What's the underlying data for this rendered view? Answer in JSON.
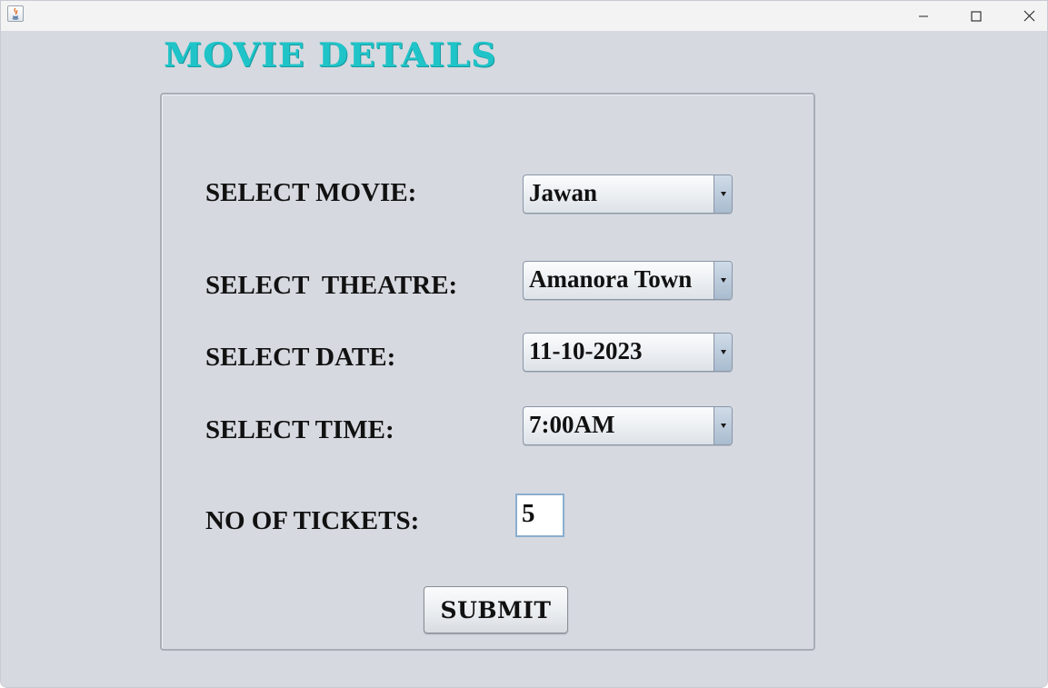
{
  "window": {
    "controls": {
      "minimize_icon": "minimize-icon",
      "maximize_icon": "maximize-icon",
      "close_icon": "close-icon"
    }
  },
  "page": {
    "title": "MOVIE DETAILS",
    "title_color": "#1fc4c8"
  },
  "form": {
    "movie": {
      "label": "SELECT MOVIE:",
      "value": "Jawan"
    },
    "theatre": {
      "label": "SELECT  THEATRE:",
      "value": "Amanora Town"
    },
    "date": {
      "label": "SELECT DATE:",
      "value": "11-10-2023"
    },
    "time": {
      "label": "SELECT TIME:",
      "value": "7:00AM"
    },
    "tickets": {
      "label": "NO OF TICKETS:",
      "value": "5"
    },
    "submit_label": "SUBMIT"
  }
}
